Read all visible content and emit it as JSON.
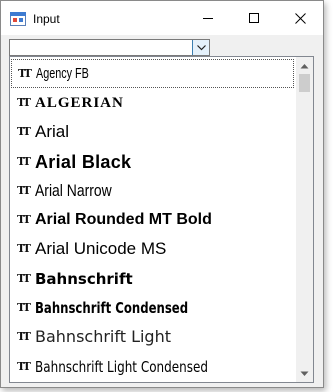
{
  "window": {
    "title": "Input"
  },
  "combo": {
    "value": ""
  },
  "list": {
    "items": [
      {
        "label": "Agency FB",
        "font_key": "agency"
      },
      {
        "label": "ALGERIAN",
        "font_key": "algerian"
      },
      {
        "label": "Arial",
        "font_key": "arial"
      },
      {
        "label": "Arial Black",
        "font_key": "arialblack"
      },
      {
        "label": "Arial Narrow",
        "font_key": "arialnarrow"
      },
      {
        "label": "Arial Rounded MT Bold",
        "font_key": "rounded"
      },
      {
        "label": "Arial Unicode MS",
        "font_key": "unicode"
      },
      {
        "label": "Bahnschrift",
        "font_key": "bahn"
      },
      {
        "label": "Bahnschrift Condensed",
        "font_key": "bahncond"
      },
      {
        "label": "Bahnschrift Light",
        "font_key": "bahnlight"
      },
      {
        "label": "Bahnschrift Light Condensed",
        "font_key": "bahnlightcond"
      }
    ],
    "item_icon": "truetype-font-icon",
    "focused_index": 0
  },
  "colors": {
    "window_bg": "#f0f0f0",
    "titlebar_bg": "#ffffff",
    "dropdown_button_bg": "#e5f1fb",
    "dropdown_button_border": "#3c7fb1"
  }
}
